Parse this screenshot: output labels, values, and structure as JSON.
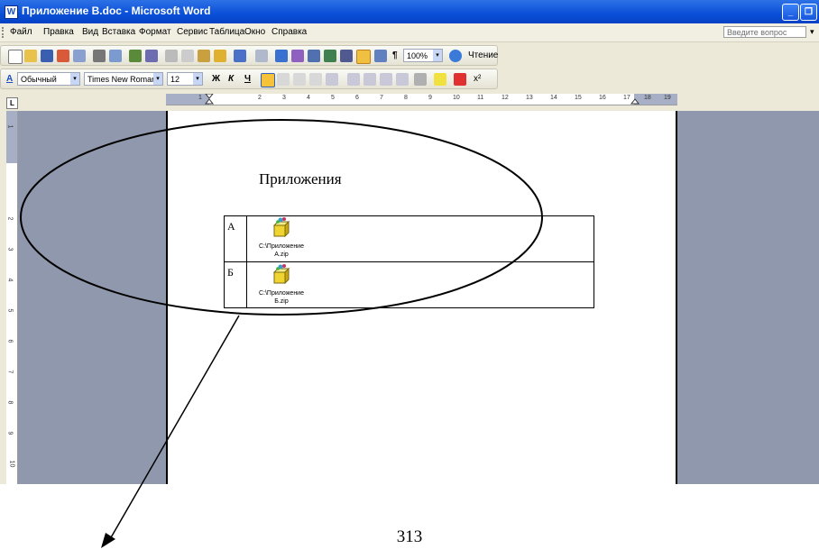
{
  "window": {
    "title": "Приложение В.doc - Microsoft Word"
  },
  "menu": {
    "items": [
      "Файл",
      "Правка",
      "Вид",
      "Вставка",
      "Формат",
      "Сервис",
      "Таблица",
      "Окно",
      "Справка"
    ],
    "ask_placeholder": "Введите вопрос"
  },
  "standard_toolbar": {
    "zoom": "100%",
    "reading_label": "Чтение"
  },
  "formatting_toolbar": {
    "style_icon": "А",
    "style": "Обычный",
    "font": "Times New Roman",
    "size": "12",
    "bold": "Ж",
    "italic": "К",
    "underline": "Ч"
  },
  "ruler": {
    "h_numbers": [
      "1",
      "2",
      "3",
      "4",
      "5",
      "6",
      "7",
      "8",
      "9",
      "10",
      "11",
      "12",
      "13",
      "14",
      "15",
      "16",
      "17",
      "18",
      "19"
    ],
    "v_numbers": [
      "1",
      "2",
      "3",
      "4",
      "5",
      "6",
      "7",
      "8",
      "9",
      "10"
    ],
    "tab_marker": "L"
  },
  "document": {
    "heading": "Приложения",
    "rows": [
      {
        "letter": "А",
        "caption_line1": "C:\\Приложение",
        "caption_line2": "А.zip"
      },
      {
        "letter": "Б",
        "caption_line1": "C:\\Приложение",
        "caption_line2": "Б.zip"
      }
    ]
  },
  "page_number": "313",
  "colors": {
    "title_bar": "#0a4fd8",
    "gray_area": "#9098ad",
    "annotation": "#000000"
  }
}
